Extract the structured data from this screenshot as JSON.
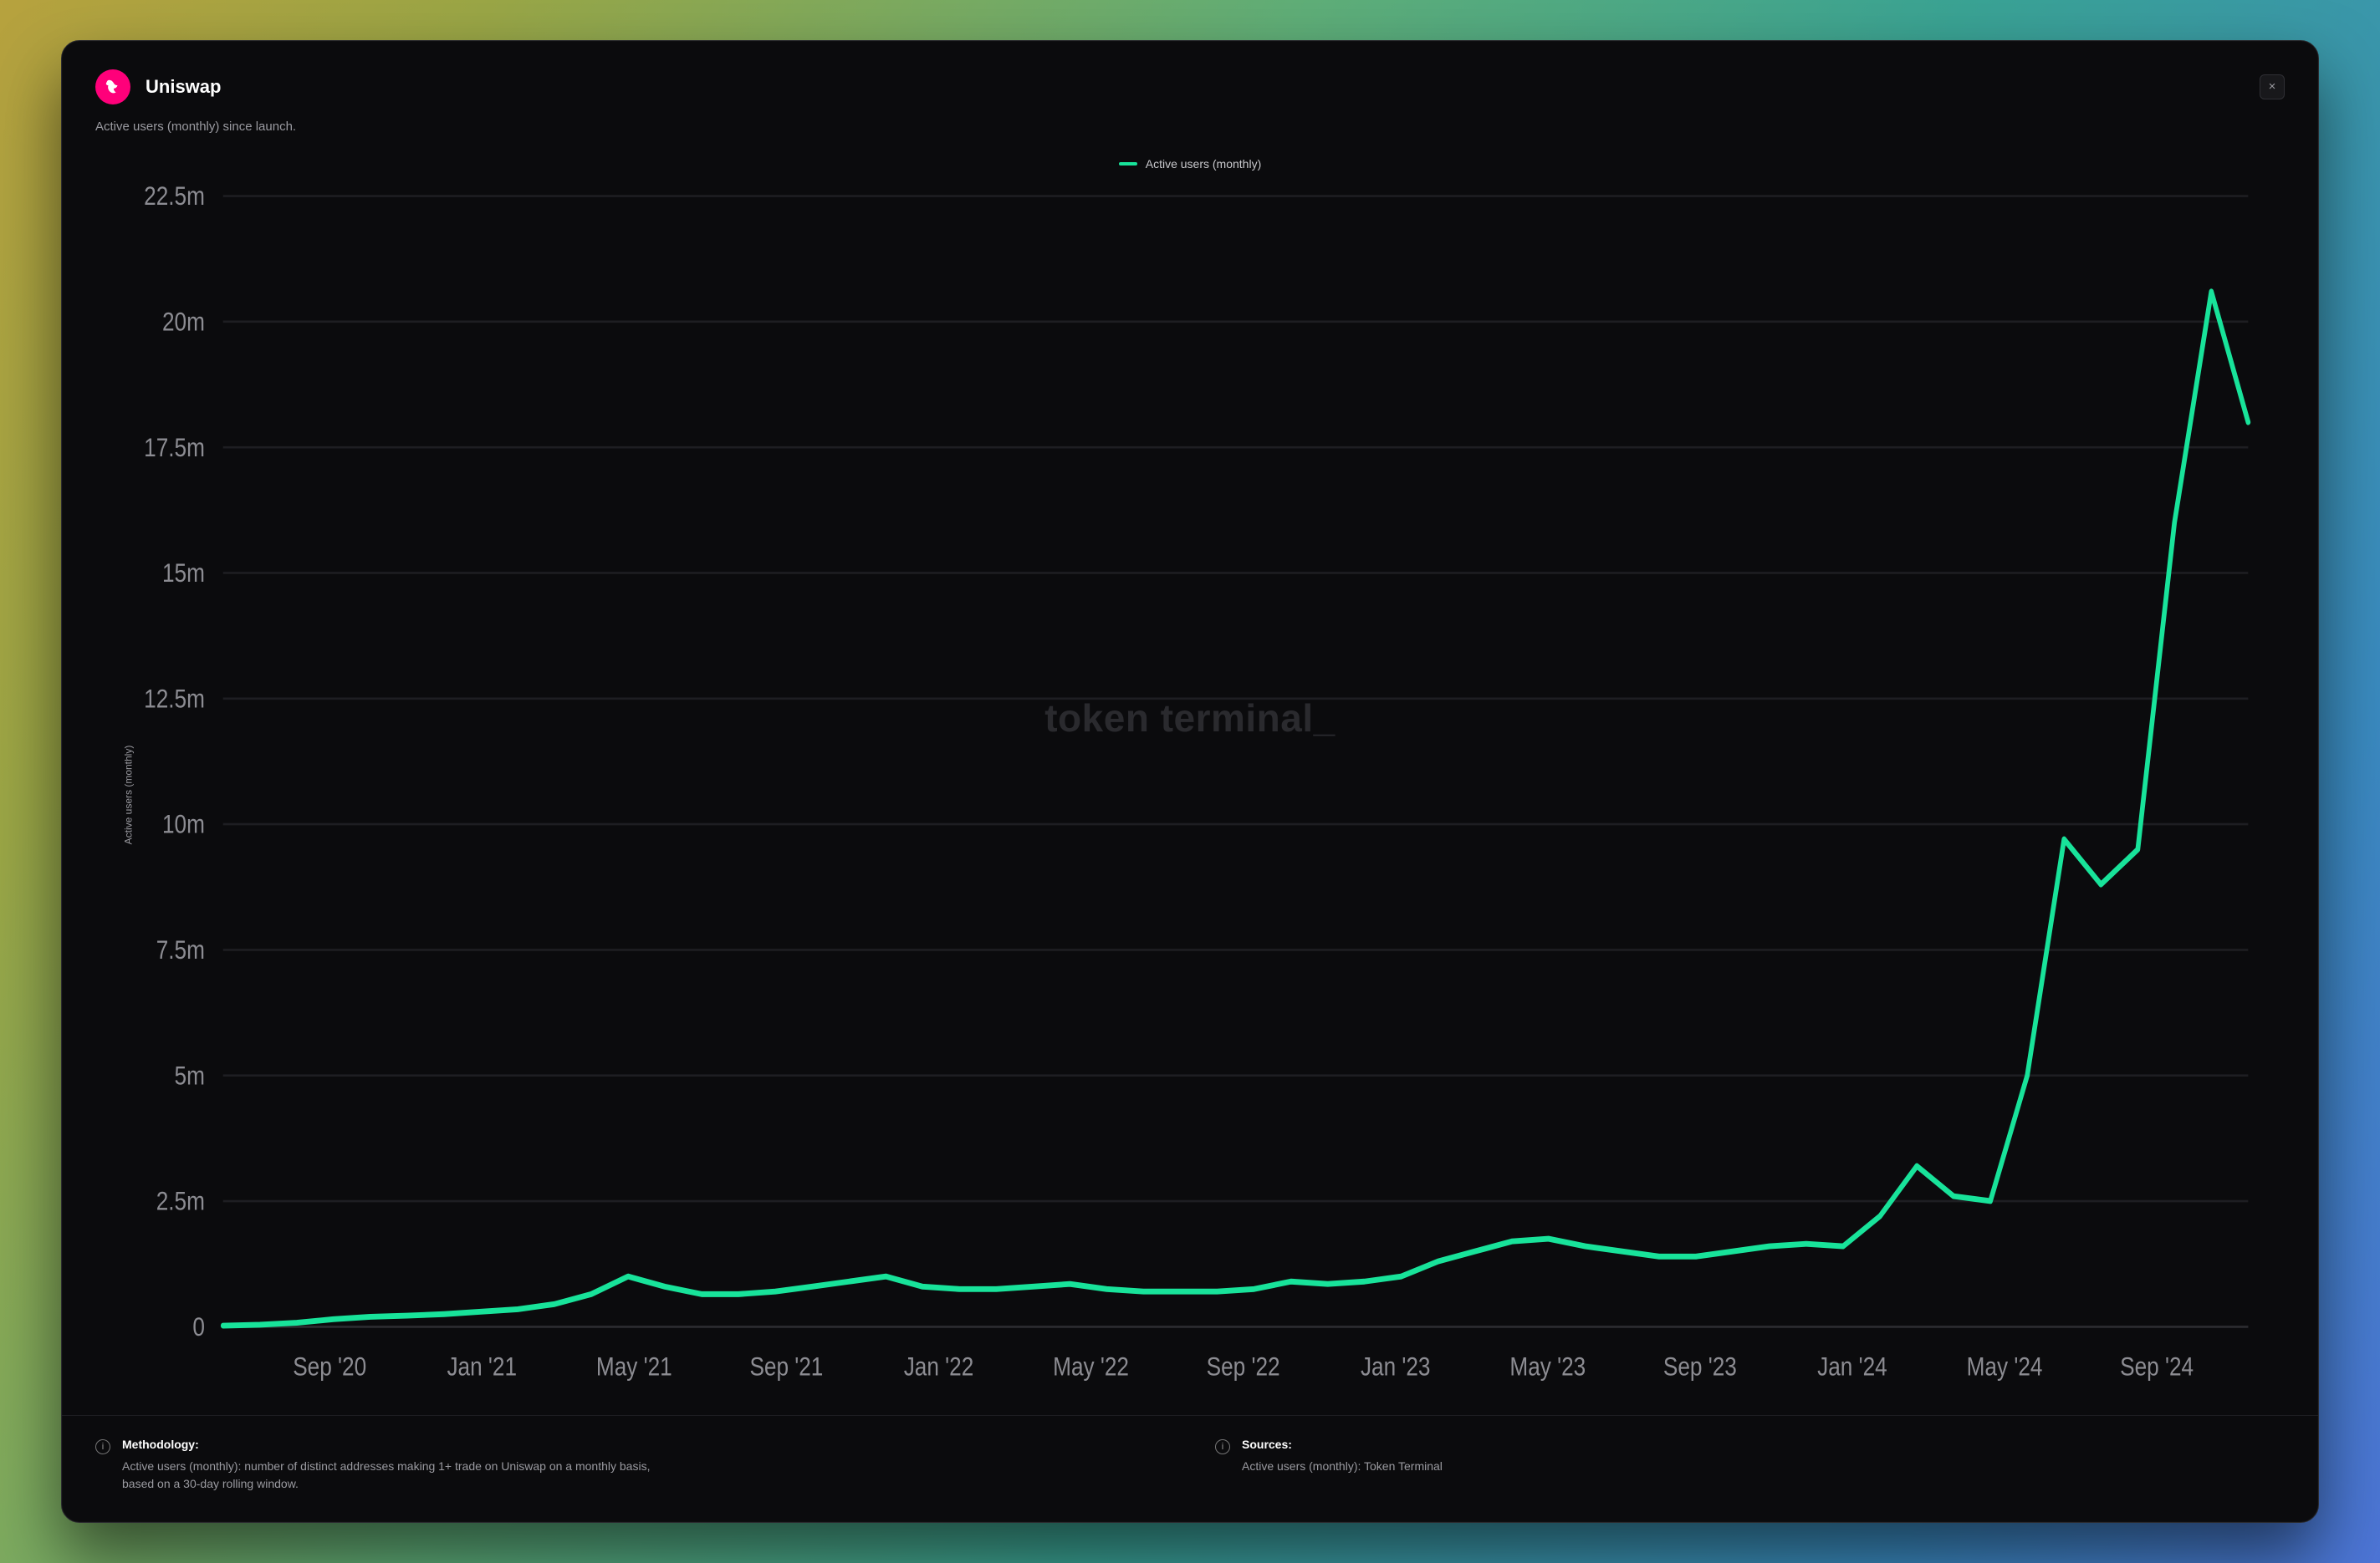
{
  "header": {
    "project": "Uniswap",
    "logo_icon": "unicorn-icon"
  },
  "subtitle": "Active users (monthly) since launch.",
  "close_label": "×",
  "legend": {
    "series_label": "Active users (monthly)"
  },
  "watermark": "token terminal",
  "footer": {
    "methodology_title": "Methodology:",
    "methodology_body": "Active users (monthly): number of distinct addresses making 1+ trade on Uniswap on a monthly basis, based on a 30-day rolling window.",
    "sources_title": "Sources:",
    "sources_body": "Active users (monthly): Token Terminal"
  },
  "colors": {
    "accent": "#18e39a",
    "brand": "#ff007a",
    "bg": "#0b0b0d"
  },
  "chart_data": {
    "type": "line",
    "ylabel": "Active users (monthly)",
    "xlabel": "",
    "ylim": [
      0,
      22500000
    ],
    "y_ticks": [
      0,
      2500000,
      5000000,
      7500000,
      10000000,
      12500000,
      15000000,
      17500000,
      20000000,
      22500000
    ],
    "y_tick_labels": [
      "0",
      "2.5m",
      "5m",
      "7.5m",
      "10m",
      "12.5m",
      "15m",
      "17.5m",
      "20m",
      "22.5m"
    ],
    "x_tick_labels": [
      "Sep '20",
      "Jan '21",
      "May '21",
      "Sep '21",
      "Jan '22",
      "May '22",
      "Sep '22",
      "Jan '23",
      "May '23",
      "Sep '23",
      "Jan '24",
      "May '24",
      "Sep '24"
    ],
    "series": [
      {
        "name": "Active users (monthly)",
        "data": [
          {
            "x": "Jun '20",
            "y": 20000
          },
          {
            "x": "Jul '20",
            "y": 40000
          },
          {
            "x": "Aug '20",
            "y": 80000
          },
          {
            "x": "Sep '20",
            "y": 150000
          },
          {
            "x": "Oct '20",
            "y": 200000
          },
          {
            "x": "Nov '20",
            "y": 220000
          },
          {
            "x": "Dec '20",
            "y": 250000
          },
          {
            "x": "Jan '21",
            "y": 300000
          },
          {
            "x": "Feb '21",
            "y": 350000
          },
          {
            "x": "Mar '21",
            "y": 450000
          },
          {
            "x": "Apr '21",
            "y": 650000
          },
          {
            "x": "May '21",
            "y": 1000000
          },
          {
            "x": "Jun '21",
            "y": 800000
          },
          {
            "x": "Jul '21",
            "y": 650000
          },
          {
            "x": "Aug '21",
            "y": 650000
          },
          {
            "x": "Sep '21",
            "y": 700000
          },
          {
            "x": "Oct '21",
            "y": 800000
          },
          {
            "x": "Nov '21",
            "y": 900000
          },
          {
            "x": "Dec '21",
            "y": 1000000
          },
          {
            "x": "Jan '22",
            "y": 800000
          },
          {
            "x": "Feb '22",
            "y": 750000
          },
          {
            "x": "Mar '22",
            "y": 750000
          },
          {
            "x": "Apr '22",
            "y": 800000
          },
          {
            "x": "May '22",
            "y": 850000
          },
          {
            "x": "Jun '22",
            "y": 750000
          },
          {
            "x": "Jul '22",
            "y": 700000
          },
          {
            "x": "Aug '22",
            "y": 700000
          },
          {
            "x": "Sep '22",
            "y": 700000
          },
          {
            "x": "Oct '22",
            "y": 750000
          },
          {
            "x": "Nov '22",
            "y": 900000
          },
          {
            "x": "Dec '22",
            "y": 850000
          },
          {
            "x": "Jan '23",
            "y": 900000
          },
          {
            "x": "Feb '23",
            "y": 1000000
          },
          {
            "x": "Mar '23",
            "y": 1300000
          },
          {
            "x": "Apr '23",
            "y": 1500000
          },
          {
            "x": "May '23",
            "y": 1700000
          },
          {
            "x": "Jun '23",
            "y": 1750000
          },
          {
            "x": "Jul '23",
            "y": 1600000
          },
          {
            "x": "Aug '23",
            "y": 1500000
          },
          {
            "x": "Sep '23",
            "y": 1400000
          },
          {
            "x": "Oct '23",
            "y": 1400000
          },
          {
            "x": "Nov '23",
            "y": 1500000
          },
          {
            "x": "Dec '23",
            "y": 1600000
          },
          {
            "x": "Jan '24",
            "y": 1650000
          },
          {
            "x": "Feb '24",
            "y": 1600000
          },
          {
            "x": "Mar '24",
            "y": 2200000
          },
          {
            "x": "Apr '24",
            "y": 3200000
          },
          {
            "x": "May '24",
            "y": 2600000
          },
          {
            "x": "Jun '24",
            "y": 2500000
          },
          {
            "x": "Jul '24",
            "y": 5000000
          },
          {
            "x": "Jul '24 (late)",
            "y": 9700000
          },
          {
            "x": "Aug '24 (early)",
            "y": 8800000
          },
          {
            "x": "Aug '24",
            "y": 9500000
          },
          {
            "x": "Sep '24",
            "y": 16000000
          },
          {
            "x": "Oct '24",
            "y": 20600000
          },
          {
            "x": "Oct '24 (late)",
            "y": 18000000
          }
        ]
      }
    ]
  }
}
